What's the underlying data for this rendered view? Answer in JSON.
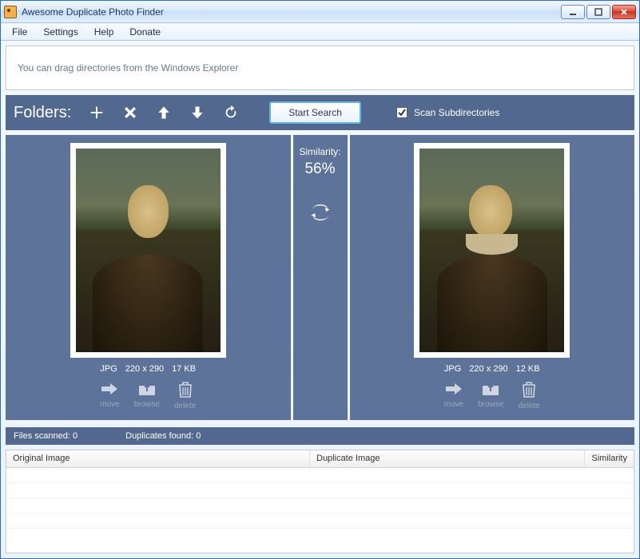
{
  "window": {
    "title": "Awesome Duplicate Photo Finder"
  },
  "menu": {
    "file": "File",
    "settings": "Settings",
    "help": "Help",
    "donate": "Donate"
  },
  "drop_hint": "You can drag directories from the Windows Explorer",
  "toolbar": {
    "folders_label": "Folders:",
    "start_search": "Start Search",
    "scan_subdirs": "Scan Subdirectories"
  },
  "similarity": {
    "label": "Similarity:",
    "value": "56%"
  },
  "left_image": {
    "format": "JPG",
    "dimensions": "220 x 290",
    "size": "17 KB",
    "actions": {
      "move": "move",
      "browse": "browse",
      "delete": "delete"
    }
  },
  "right_image": {
    "format": "JPG",
    "dimensions": "220 x 290",
    "size": "12 KB",
    "actions": {
      "move": "move",
      "browse": "browse",
      "delete": "delete"
    }
  },
  "status": {
    "files_scanned_label": "Files scanned:",
    "files_scanned_value": "0",
    "duplicates_found_label": "Duplicates found:",
    "duplicates_found_value": "0"
  },
  "results": {
    "columns": {
      "original": "Original Image",
      "duplicate": "Duplicate Image",
      "similarity": "Similarity"
    }
  }
}
